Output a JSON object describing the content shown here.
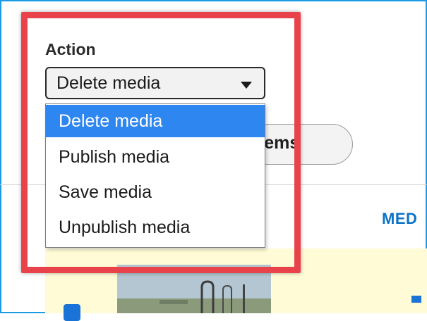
{
  "action": {
    "label": "Action",
    "selected_value": "Delete media",
    "options": [
      "Delete media",
      "Publish media",
      "Save media",
      "Unpublish media"
    ]
  },
  "apply_button": {
    "label_visible": "items"
  },
  "table": {
    "column_header_visible": "MED"
  },
  "colors": {
    "highlight_border": "#e8434a",
    "selected_option_bg": "#2e86f0",
    "link_blue": "#0a73c8",
    "row_highlight": "#fffbd6"
  }
}
